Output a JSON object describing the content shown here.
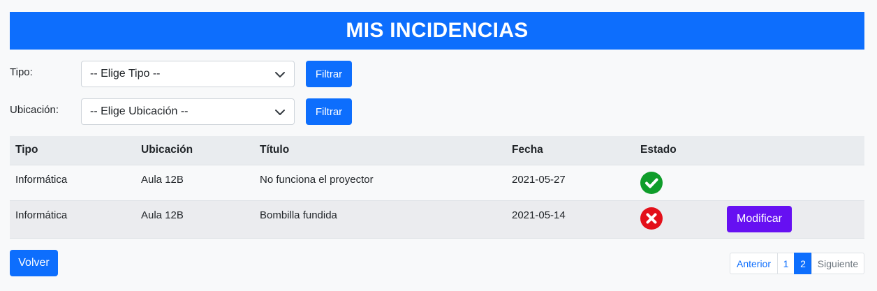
{
  "header": {
    "title": "MIS INCIDENCIAS"
  },
  "filters": [
    {
      "label": "Tipo:",
      "selected": "-- Elige Tipo --",
      "button": "Filtrar"
    },
    {
      "label": "Ubicación:",
      "selected": "-- Elige Ubicación --",
      "button": "Filtrar"
    }
  ],
  "table": {
    "columns": [
      "Tipo",
      "Ubicación",
      "Título",
      "Fecha",
      "Estado"
    ],
    "rows": [
      {
        "tipo": "Informática",
        "ubicacion": "Aula 12B",
        "titulo": "No funciona el proyector",
        "fecha": "2021-05-27",
        "estado": "check-circle-icon"
      },
      {
        "tipo": "Informática",
        "ubicacion": "Aula 12B",
        "titulo": "Bombilla fundida",
        "fecha": "2021-05-14",
        "estado": "x-circle-icon",
        "action": "Modificar"
      }
    ]
  },
  "footer": {
    "back_button": "Volver"
  },
  "pagination": {
    "prev": "Anterior",
    "pages": [
      "1",
      "2"
    ],
    "current": "2",
    "next": "Siguiente"
  },
  "colors": {
    "primary": "#0d6efd",
    "purple": "#6610f2",
    "success": "#0f9d2a",
    "danger": "#e3101a"
  }
}
